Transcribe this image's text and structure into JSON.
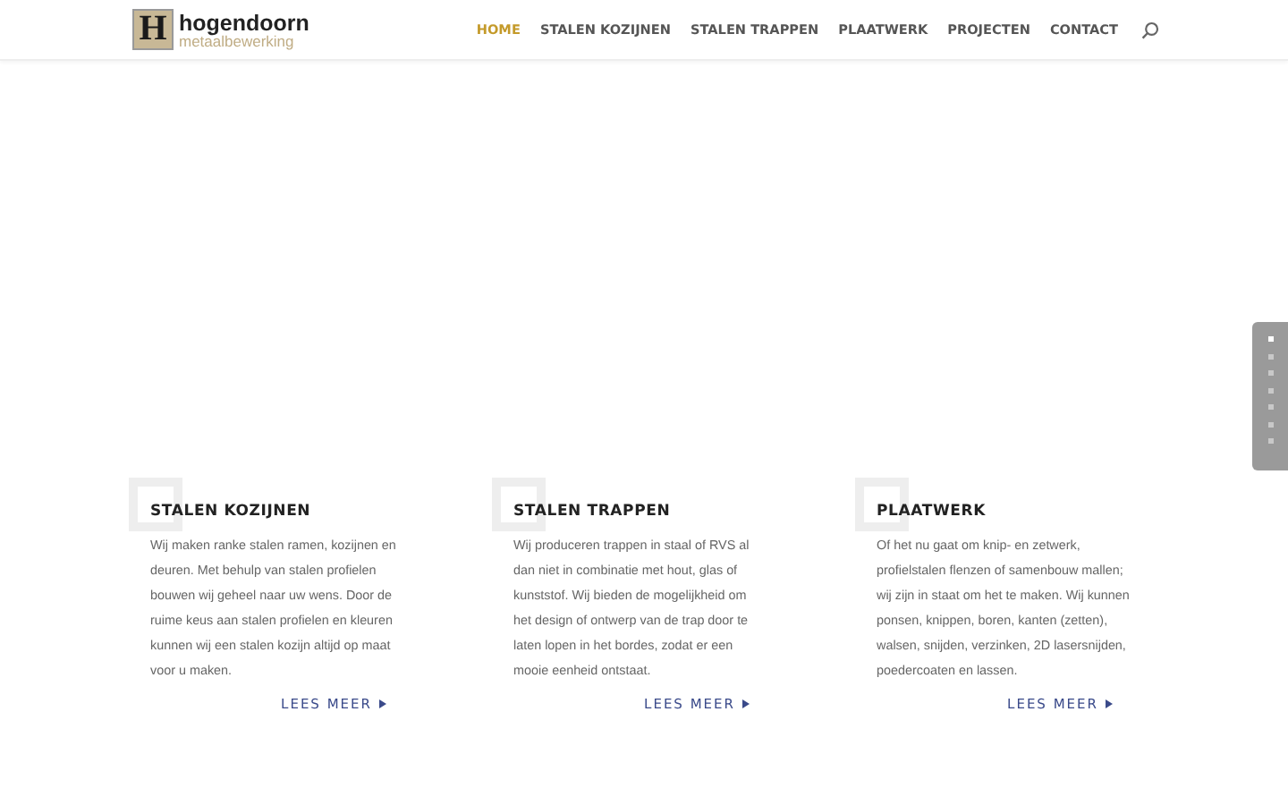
{
  "logo": {
    "name": "hogendoorn",
    "tagline": "metaalbewerking",
    "mark": "H"
  },
  "nav": [
    {
      "label": "HOME",
      "selected": true
    },
    {
      "label": "STALEN KOZIJNEN",
      "selected": false
    },
    {
      "label": "STALEN TRAPPEN",
      "selected": false
    },
    {
      "label": "PLAATWERK",
      "selected": false
    },
    {
      "label": "PROJECTEN",
      "selected": false
    },
    {
      "label": "CONTACT",
      "selected": false
    }
  ],
  "slider_dots": [
    {
      "selected": true
    },
    {
      "selected": false
    },
    {
      "selected": false
    },
    {
      "selected": false
    },
    {
      "selected": false
    },
    {
      "selected": false
    },
    {
      "selected": false
    }
  ],
  "services": [
    {
      "title": "STALEN KOZIJNEN",
      "text": "Wij maken ranke stalen ramen, kozijnen en deuren. Met behulp van stalen profielen bouwen wij geheel naar uw wens. Door de ruime keus aan stalen profielen en kleuren kunnen wij een stalen kozijn altijd op maat voor u maken.",
      "link": "LEES MEER"
    },
    {
      "title": "STALEN TRAPPEN",
      "text": "Wij produceren trappen in staal of RVS al dan niet in combinatie met hout, glas of kunststof. Wij bieden de mogelijkheid om het design of ontwerp van de trap door te laten lopen in het bordes, zodat er een mooie eenheid ontstaat.",
      "link": "LEES MEER"
    },
    {
      "title": "PLAATWERK",
      "text": "Of het nu gaat om knip- en zetwerk, profielstalen flenzen of samenbouw mallen; wij zijn in staat om het te maken. Wij kunnen ponsen, knippen, boren, kanten (zetten), walsen, snijden, verzinken, 2D lasersnijden, poedercoaten en lassen.",
      "link": "LEES MEER"
    }
  ]
}
